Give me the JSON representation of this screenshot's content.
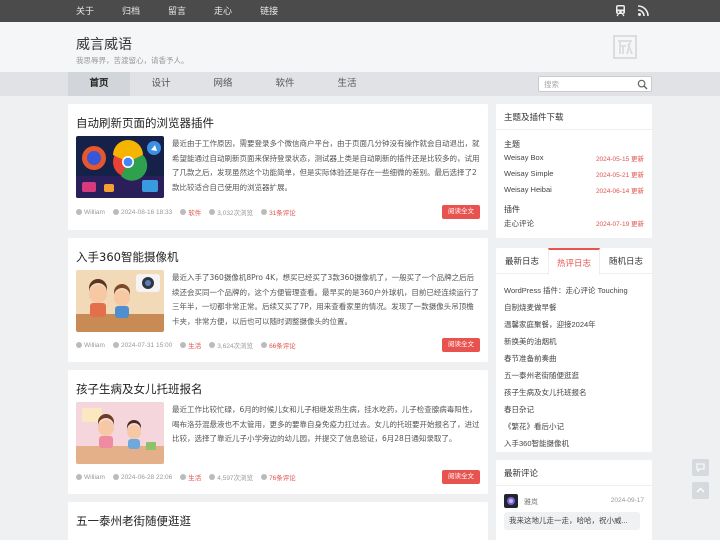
{
  "topnav": {
    "items": [
      "关于",
      "归档",
      "留言",
      "走心",
      "链接"
    ]
  },
  "topicons": [
    "train-icon",
    "rss-icon"
  ],
  "header": {
    "title": "威言威语",
    "description": "我思辱界，苦渡留心，请香予人。",
    "logo_icon": "wei-seal-icon"
  },
  "mainnav": {
    "items": [
      "首页",
      "设计",
      "网络",
      "软件",
      "生活"
    ],
    "active": "首页"
  },
  "search": {
    "placeholder": "搜索",
    "icon": "search-icon"
  },
  "posts": [
    {
      "title": "自动刷新页面的浏览器插件",
      "excerpt": "最近由于工作原因，需要登录多个微信商户平台，由于页面几分钟没有操作就会自动退出，就希望能通过自动刷新页面来保持登录状态，测试器上类是自动刷新的插件还是比较多的，试用了几款之后，发现虽然这个功能简单，但是实际体验还是存在一些细微的差别。最后选择了2款比较适合自己使用的浏览器扩展。",
      "author": "William",
      "date": "2024-08-16 18:33",
      "category": "软件",
      "views": "3,032次浏览",
      "comments": "31条评论",
      "read": "阅读全文"
    },
    {
      "title": "入手360智能摄像机",
      "excerpt": "最近入手了360摄像机8Pro 4K，想买已经买了3款360摄像机了，一般买了一个品牌之后后续还会买同一个品牌的，这个方便管理查看。最早买的是360户外球机，目前已经连续运行了三年半，一切都非常正常。后续又买了7P，用来查看家里的情况。发现了一款摄像头吊顶檐卡夹，非常方便，以后也可以随时调整摄像头的位置。",
      "author": "William",
      "date": "2024-07-31 15:00",
      "category": "生活",
      "views": "3,624次浏览",
      "comments": "66条评论",
      "read": "阅读全文"
    },
    {
      "title": "孩子生病及女儿托班报名",
      "excerpt": "最近工作比较忙碌，6月的时候儿女和儿子相继发热生病，挂水吃药，儿子检查腺病毒阳性，喝布洛芬混悬液也不太管用，更多的要靠自身免疫力扛过去。女儿的托班要开始报名了，进过比较，选择了靠近儿子小学旁边的幼儿园，并提交了信息验证，6月28日通知录取了。",
      "author": "William",
      "date": "2024-06-28 22:06",
      "category": "生活",
      "views": "4,597次浏览",
      "comments": "76条评论",
      "read": "阅读全文"
    },
    {
      "title": "五一泰州老街随便逛逛"
    }
  ],
  "themes_widget": {
    "heading": "主题及插件下载",
    "themes_label": "主题",
    "themes": [
      {
        "name": "Weisay Box",
        "date": "2024-05-15 更新"
      },
      {
        "name": "Weisay Simple",
        "date": "2024-05-21 更新"
      },
      {
        "name": "Weisay Heibai",
        "date": "2024-06-14 更新"
      }
    ],
    "plugins_label": "插件",
    "plugins": [
      {
        "name": "走心评论",
        "date": "2024-07-19 更新"
      }
    ]
  },
  "log_widget": {
    "tabs": [
      "最新日志",
      "热评日志",
      "随机日志"
    ],
    "active_tab": "热评日志",
    "items": [
      "WordPress 插件：走心评论 Touching",
      "自制烧麦做早餐",
      "温馨家庭聚餐，迎接2024年",
      "新换美的油烟机",
      "春节准备前奏曲",
      "五一泰州老街随便逛逛",
      "孩子生病及女儿托班报名",
      "春日杂记",
      "《繁花》看后小记",
      "入手360智能摄像机"
    ]
  },
  "comment_widget": {
    "heading": "最新评论",
    "name": "雅岚",
    "date": "2024-09-17",
    "text": "我来这地儿走一走，哈哈，祝小威..."
  },
  "float_buttons": [
    "comment-icon",
    "back-to-top-icon"
  ],
  "colors": {
    "accent": "#e8534f",
    "topbar": "#4b4b4b",
    "background": "#eef0f2"
  }
}
